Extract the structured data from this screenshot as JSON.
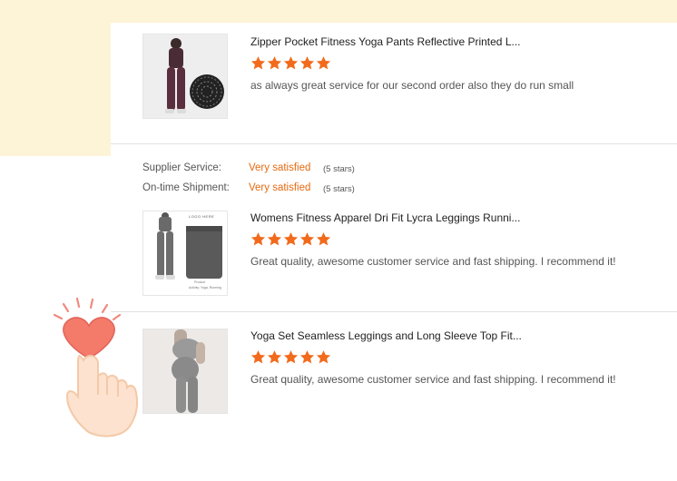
{
  "colors": {
    "accent": "#f26a1b",
    "star": "#f26a1b",
    "bg": "#fdf3d6"
  },
  "reviews": [
    {
      "title": "Zipper Pocket Fitness Yoga Pants Reflective Printed L...",
      "rating": 5,
      "text": "as always great service for our second order also they do run small"
    },
    {
      "title": "Womens Fitness Apparel Dri Fit Lycra Leggings Runni...",
      "rating": 5,
      "text": "Great quality, awesome customer service and fast shipping. I recommend it!"
    },
    {
      "title": "Yoga Set Seamless Leggings and Long Sleeve Top Fit...",
      "rating": 5,
      "text": "Great quality, awesome customer service and fast shipping. I recommend it!"
    }
  ],
  "ratings": {
    "supplier_label": "Supplier Service:",
    "supplier_value": "Very satisfied",
    "supplier_stars": "(5 stars)",
    "shipment_label": "On-time Shipment:",
    "shipment_value": "Very satisfied",
    "shipment_stars": "(5 stars)"
  },
  "thumb_caption": {
    "brand": "LOGO HERE",
    "line1": "Product",
    "line2": "Activity: Yoga, Running"
  },
  "icons": [
    "star-icon",
    "heart-icon",
    "pointing-hand-icon"
  ]
}
